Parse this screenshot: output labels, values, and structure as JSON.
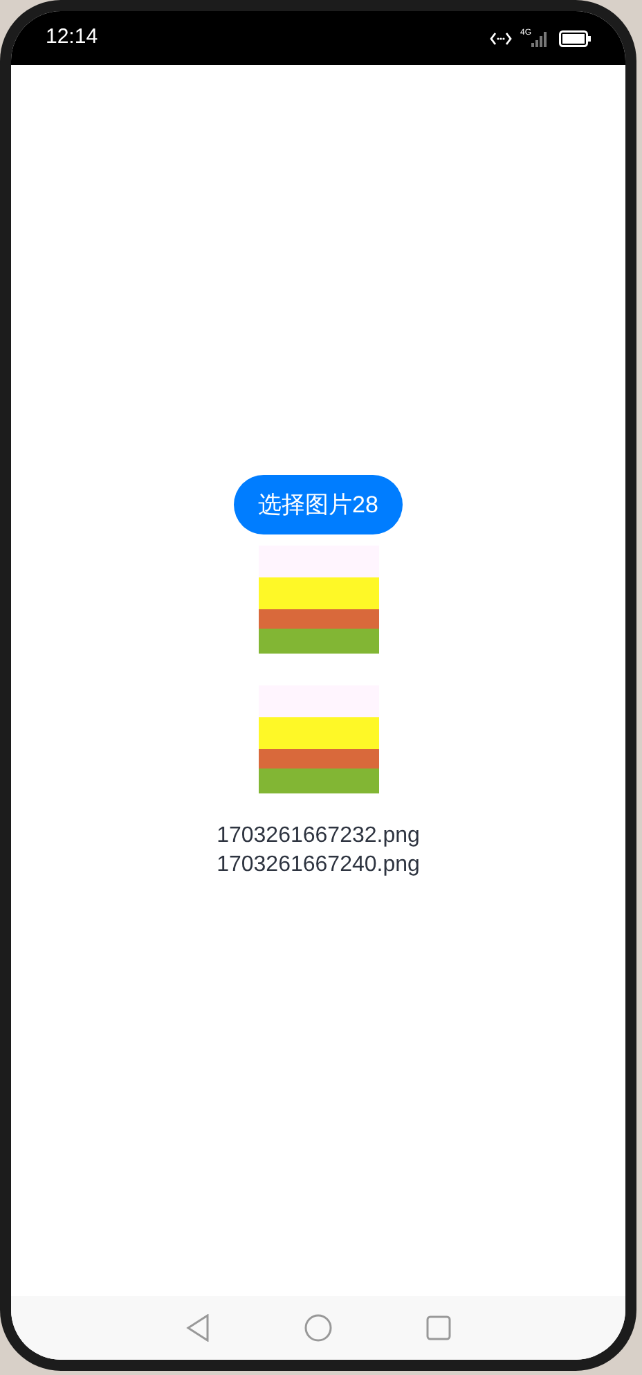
{
  "status_bar": {
    "time": "12:14",
    "network": "4G"
  },
  "button": {
    "label": "选择图片28"
  },
  "file_names": [
    "1703261667232.png",
    "1703261667240.png"
  ]
}
